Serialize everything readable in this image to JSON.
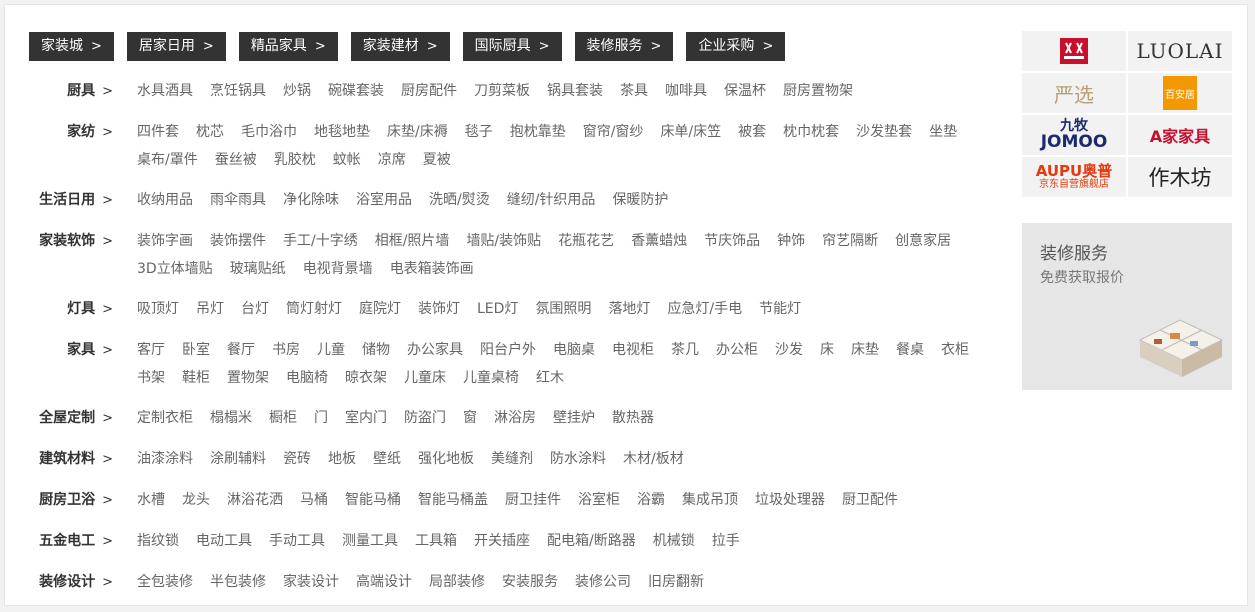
{
  "top_tabs": [
    {
      "label": "家装城"
    },
    {
      "label": "居家日用"
    },
    {
      "label": "精品家具"
    },
    {
      "label": "家装建材"
    },
    {
      "label": "国际厨具"
    },
    {
      "label": "装修服务"
    },
    {
      "label": "企业采购"
    }
  ],
  "chevron": ">",
  "categories": [
    {
      "title": "厨具",
      "items": [
        "水具酒具",
        "烹饪锅具",
        "炒锅",
        "碗碟套装",
        "厨房配件",
        "刀剪菜板",
        "锅具套装",
        "茶具",
        "咖啡具",
        "保温杯",
        "厨房置物架"
      ]
    },
    {
      "title": "家纺",
      "items": [
        "四件套",
        "枕芯",
        "毛巾浴巾",
        "地毯地垫",
        "床垫/床褥",
        "毯子",
        "抱枕靠垫",
        "窗帘/窗纱",
        "床单/床笠",
        "被套",
        "枕巾枕套",
        "沙发垫套",
        "坐垫",
        "桌布/罩件",
        "蚕丝被",
        "乳胶枕",
        "蚊帐",
        "凉席",
        "夏被"
      ]
    },
    {
      "title": "生活日用",
      "items": [
        "收纳用品",
        "雨伞雨具",
        "净化除味",
        "浴室用品",
        "洗晒/熨烫",
        "缝纫/针织用品",
        "保暖防护"
      ]
    },
    {
      "title": "家装软饰",
      "items": [
        "装饰字画",
        "装饰摆件",
        "手工/十字绣",
        "相框/照片墙",
        "墙贴/装饰贴",
        "花瓶花艺",
        "香薰蜡烛",
        "节庆饰品",
        "钟饰",
        "帘艺隔断",
        "创意家居",
        "3D立体墙贴",
        "玻璃贴纸",
        "电视背景墙",
        "电表箱装饰画"
      ]
    },
    {
      "title": "灯具",
      "items": [
        "吸顶灯",
        "吊灯",
        "台灯",
        "筒灯射灯",
        "庭院灯",
        "装饰灯",
        "LED灯",
        "氛围照明",
        "落地灯",
        "应急灯/手电",
        "节能灯"
      ]
    },
    {
      "title": "家具",
      "items": [
        "客厅",
        "卧室",
        "餐厅",
        "书房",
        "儿童",
        "储物",
        "办公家具",
        "阳台户外",
        "电脑桌",
        "电视柜",
        "茶几",
        "办公柜",
        "沙发",
        "床",
        "床垫",
        "餐桌",
        "衣柜",
        "书架",
        "鞋柜",
        "置物架",
        "电脑椅",
        "晾衣架",
        "儿童床",
        "儿童桌椅",
        "红木"
      ]
    },
    {
      "title": "全屋定制",
      "items": [
        "定制衣柜",
        "榻榻米",
        "橱柜",
        "门",
        "室内门",
        "防盗门",
        "窗",
        "淋浴房",
        "壁挂炉",
        "散热器"
      ]
    },
    {
      "title": "建筑材料",
      "items": [
        "油漆涂料",
        "涂刷辅料",
        "瓷砖",
        "地板",
        "壁纸",
        "强化地板",
        "美缝剂",
        "防水涂料",
        "木材/板材"
      ]
    },
    {
      "title": "厨房卫浴",
      "items": [
        "水槽",
        "龙头",
        "淋浴花洒",
        "马桶",
        "智能马桶",
        "智能马桶盖",
        "厨卫挂件",
        "浴室柜",
        "浴霸",
        "集成吊顶",
        "垃圾处理器",
        "厨卫配件"
      ]
    },
    {
      "title": "五金电工",
      "items": [
        "指纹锁",
        "电动工具",
        "手动工具",
        "测量工具",
        "工具箱",
        "开关插座",
        "配电箱/断路器",
        "机械锁",
        "拉手"
      ]
    },
    {
      "title": "装修设计",
      "items": [
        "全包装修",
        "半包装修",
        "家装设计",
        "高端设计",
        "局部装修",
        "安装服务",
        "装修公司",
        "旧房翻新"
      ]
    }
  ],
  "brands": [
    {
      "name": "双立人",
      "color": "#c8102e"
    },
    {
      "name": "LUOLAI 罗莱生活",
      "color": "#333333"
    },
    {
      "name": "网易严选",
      "color": "#b4a078"
    },
    {
      "name": "百安居",
      "color": "#f39800"
    },
    {
      "name": "九牧 JOMOO",
      "color": "#1d2a6b"
    },
    {
      "name": "A家家具",
      "color": "#c8102e"
    },
    {
      "name": "AUPU奥普 京东自营旗舰店",
      "color": "#e8380d"
    },
    {
      "name": "作木坊",
      "color": "#222222"
    }
  ],
  "promo": {
    "title": "装修服务",
    "subtitle": "免费获取报价"
  }
}
